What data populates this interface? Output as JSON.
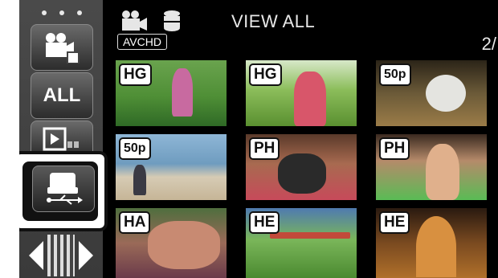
{
  "header": {
    "title": "VIEW ALL",
    "format_label": "AVCHD",
    "page_indicator": "2/"
  },
  "sidebar": {
    "all_label": "ALL"
  },
  "thumbnails": [
    {
      "badge": "HG"
    },
    {
      "badge": "HG"
    },
    {
      "badge": "50p"
    },
    {
      "badge": "50p"
    },
    {
      "badge": "PH"
    },
    {
      "badge": "PH"
    },
    {
      "badge": "HA"
    },
    {
      "badge": "HE"
    },
    {
      "badge": "HE"
    }
  ],
  "icons": {
    "movie": "movie-camera-icon",
    "storage": "database-icon",
    "copy": "copy-drive-usb-icon",
    "play_mode": "play-mode-icon",
    "prev": "left-arrow-icon",
    "next": "right-arrow-icon"
  },
  "colors": {
    "background": "#000000",
    "sidebar": "#444444",
    "highlight_border": "#111111",
    "text": "#ffffff"
  }
}
